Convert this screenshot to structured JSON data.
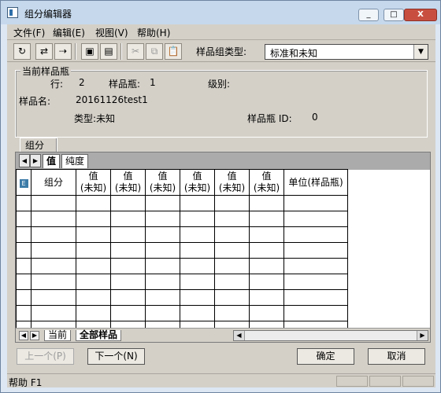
{
  "window": {
    "title": "组分编辑器",
    "controls": {
      "minimize": "_",
      "maximize": "□",
      "close": "X"
    }
  },
  "menu": [
    "文件(F)",
    "编辑(E)",
    "视图(V)",
    "帮助(H)"
  ],
  "toolbar": {
    "label": "样品组类型:",
    "select_value": "标准和未知"
  },
  "current_sample": {
    "title": "当前样品瓶",
    "row_label": "行:",
    "row_value": "2",
    "vial_label": "样品瓶:",
    "vial_value": "1",
    "level_label": "级别:",
    "level_value": "",
    "name_label": "样品名:",
    "name_value": "20161126test1",
    "type_text": "类型:未知",
    "vial_id_label": "样品瓶 ID:",
    "vial_id_value": "0"
  },
  "tabs": {
    "top_tab": "组分",
    "sub_tabs": [
      "值",
      "纯度"
    ]
  },
  "table": {
    "headers": [
      "组分",
      "值\n(未知)",
      "值\n(未知)",
      "值\n(未知)",
      "值\n(未知)",
      "值\n(未知)",
      "值\n(未知)",
      "单位(样品瓶)"
    ]
  },
  "bottom_tabs": [
    "当前",
    "全部样品"
  ],
  "buttons": {
    "prev": "上一个(P)",
    "next": "下一个(N)",
    "ok": "确定",
    "cancel": "取消"
  },
  "statusbar": {
    "text": "帮助 F1"
  }
}
